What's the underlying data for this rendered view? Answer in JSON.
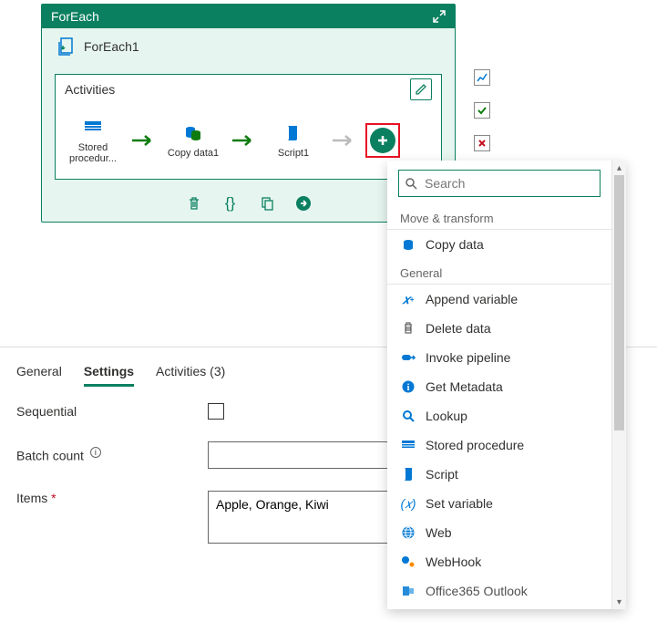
{
  "card": {
    "header_title": "ForEach",
    "name": "ForEach1",
    "activities_label": "Activities",
    "nodes": [
      {
        "label": "Stored procedur...",
        "kind": "stored-procedure"
      },
      {
        "label": "Copy data1",
        "kind": "copy-data"
      },
      {
        "label": "Script1",
        "kind": "script"
      }
    ]
  },
  "tabs": {
    "general": "General",
    "settings": "Settings",
    "activities": "Activities (3)"
  },
  "form": {
    "sequential_label": "Sequential",
    "batch_label": "Batch count",
    "batch_value": "",
    "items_label": "Items",
    "items_value": "Apple, Orange, Kiwi"
  },
  "popup": {
    "search_placeholder": "Search",
    "sections": {
      "move_transform": "Move & transform",
      "general": "General"
    },
    "items": {
      "copy_data": "Copy data",
      "append_variable": "Append variable",
      "delete_data": "Delete data",
      "invoke_pipeline": "Invoke pipeline",
      "get_metadata": "Get Metadata",
      "lookup": "Lookup",
      "stored_procedure": "Stored procedure",
      "script": "Script",
      "set_variable": "Set variable",
      "web": "Web",
      "webhook": "WebHook",
      "office365": "Office365 Outlook"
    }
  },
  "colors": {
    "primary": "#0b8060",
    "azure_blue": "#0078d4"
  }
}
